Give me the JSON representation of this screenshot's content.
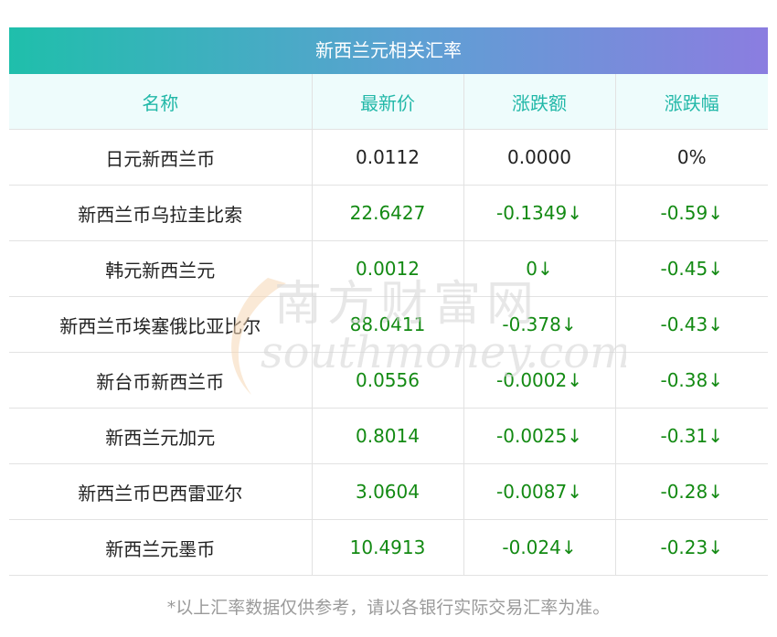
{
  "table_title": "新西兰元相关汇率",
  "headers": [
    "名称",
    "最新价",
    "涨跌额",
    "涨跌幅"
  ],
  "rows": [
    {
      "name": "日元新西兰币",
      "price": "0.0112",
      "change": "0.0000",
      "pct": "0%",
      "trend": "flat"
    },
    {
      "name": "新西兰币乌拉圭比索",
      "price": "22.6427",
      "change": "-0.1349↓",
      "pct": "-0.59↓",
      "trend": "down"
    },
    {
      "name": "韩元新西兰元",
      "price": "0.0012",
      "change": "0↓",
      "pct": "-0.45↓",
      "trend": "down"
    },
    {
      "name": "新西兰币埃塞俄比亚比尔",
      "price": "88.0411",
      "change": "-0.378↓",
      "pct": "-0.43↓",
      "trend": "down"
    },
    {
      "name": "新台币新西兰币",
      "price": "0.0556",
      "change": "-0.0002↓",
      "pct": "-0.38↓",
      "trend": "down"
    },
    {
      "name": "新西兰元加元",
      "price": "0.8014",
      "change": "-0.0025↓",
      "pct": "-0.31↓",
      "trend": "down"
    },
    {
      "name": "新西兰币巴西雷亚尔",
      "price": "3.0604",
      "change": "-0.0087↓",
      "pct": "-0.28↓",
      "trend": "down"
    },
    {
      "name": "新西兰元墨币",
      "price": "10.4913",
      "change": "-0.024↓",
      "pct": "-0.23↓",
      "trend": "down"
    }
  ],
  "watermark": {
    "cn": "南方财富网",
    "en": "southmoney.com"
  },
  "footnote": "*以上汇率数据仅供参考，请以各银行实际交易汇率为准。",
  "colors": {
    "header_text": "#22b8a8",
    "down": "#138a13",
    "gradient_start": "#1fbfab",
    "gradient_end": "#8b7de0"
  }
}
